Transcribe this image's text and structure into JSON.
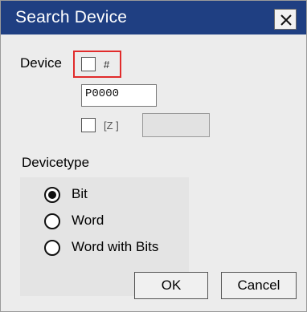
{
  "window": {
    "title": "Search Device"
  },
  "device": {
    "label": "Device",
    "hash_checkbox": {
      "label": "#",
      "checked": false
    },
    "value": "P0000",
    "z_checkbox": {
      "label": "[Z ]",
      "checked": false
    },
    "z_value": ""
  },
  "devicetype": {
    "label": "Devicetype",
    "options": [
      "Bit",
      "Word",
      "Word with Bits"
    ],
    "selected": "Bit"
  },
  "buttons": {
    "ok": "OK",
    "cancel": "Cancel"
  },
  "colors": {
    "titlebar": "#1f3f82",
    "highlight": "#e12b2b",
    "background": "#ececec"
  }
}
